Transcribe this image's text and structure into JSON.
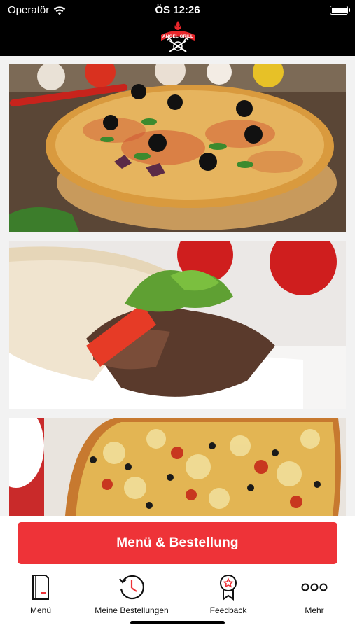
{
  "status_bar": {
    "carrier": "Operatör",
    "time": "ÖS 12:26"
  },
  "header": {
    "logo_text": "ANGEL GRILL"
  },
  "cards": [
    {
      "name": "pizza-card"
    },
    {
      "name": "doner-wrap-card"
    },
    {
      "name": "pizza-2-card"
    }
  ],
  "order_button": {
    "label": "Menü & Bestellung"
  },
  "tabs": [
    {
      "label": "Menü",
      "icon": "menu-book-icon"
    },
    {
      "label": "Meine Bestellungen",
      "icon": "history-clock-icon"
    },
    {
      "label": "Feedback",
      "icon": "award-ribbon-icon"
    },
    {
      "label": "Mehr",
      "icon": "more-dots-icon"
    }
  ],
  "colors": {
    "accent": "#ee3338",
    "header_bg": "#000000",
    "background": "#f2f2f2"
  }
}
